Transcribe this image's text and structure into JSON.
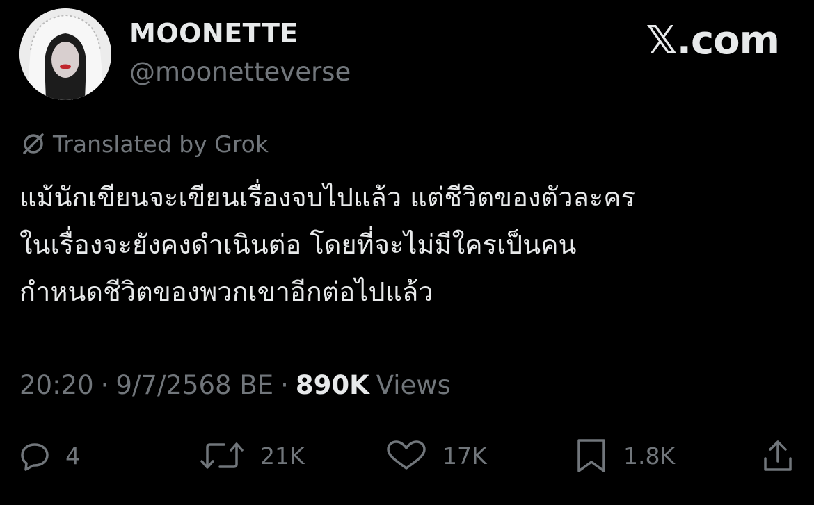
{
  "header": {
    "display_name": "MOONETTE",
    "handle": "@moonetteverse",
    "brand": "𝕏.com"
  },
  "translation": {
    "label": "Translated by Grok",
    "icon": "grok-icon"
  },
  "tweet": {
    "lines": [
      "แม้นักเขียนจะเขียนเรื่องจบไปแล้ว แต่ชีวิตของตัวละคร",
      "ในเรื่องจะยังคงดำเนินต่อ โดยที่จะไม่มีใครเป็นคน",
      "กำหนดชีวิตของพวกเขาอีกต่อไปแล้ว"
    ]
  },
  "meta": {
    "time": "20:20",
    "date": "9/7/2568 BE",
    "separator": "·",
    "views_count": "890K",
    "views_label": "Views"
  },
  "actions": {
    "reply": {
      "icon": "reply-icon",
      "count": "4"
    },
    "repost": {
      "icon": "repost-icon",
      "count": "21K"
    },
    "like": {
      "icon": "heart-icon",
      "count": "17K"
    },
    "bookmark": {
      "icon": "bookmark-icon",
      "count": "1.8K"
    },
    "share": {
      "icon": "share-icon"
    }
  },
  "colors": {
    "background": "#000000",
    "primary_text": "#e7e9ea",
    "secondary_text": "#71767b"
  }
}
